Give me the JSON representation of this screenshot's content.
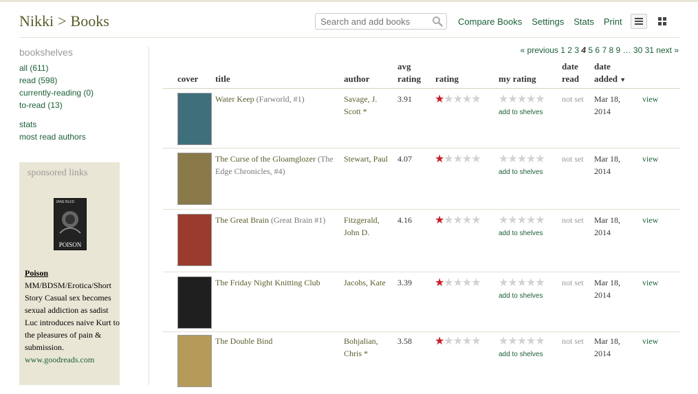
{
  "header": {
    "user": "Nikki",
    "separator": ">",
    "section": "Books",
    "search_placeholder": "Search and add books",
    "links": [
      "Compare Books",
      "Settings",
      "Stats",
      "Print"
    ],
    "divider": "|"
  },
  "sidebar": {
    "title": "bookshelves",
    "shelves": [
      "all (611)",
      "read (598)",
      "currently-reading (0)",
      "to-read (13)"
    ],
    "links": [
      "stats",
      "most read authors"
    ]
  },
  "sponsored": {
    "title": "sponsored links",
    "cover_title": "POISON",
    "cover_author": "JANE BLED",
    "ad_title": "Poison",
    "ad_body": "MM/BDSM/Erotica/Short Story Casual sex becomes sexual addiction as sadist Luc introduces naive Kurt to the pleasures of pain & submission.",
    "ad_url": "www.goodreads.com"
  },
  "pagination": {
    "previous": "« previous",
    "pages": [
      "1",
      "2",
      "3",
      "4",
      "5",
      "6",
      "7",
      "8",
      "9"
    ],
    "current": "4",
    "ellipsis": "…",
    "tail_pages": [
      "30",
      "31"
    ],
    "next": "next »"
  },
  "columns": {
    "cover": "cover",
    "title": "title",
    "author": "author",
    "avg_rating_1": "avg",
    "avg_rating_2": "rating",
    "rating": "rating",
    "my_rating": "my rating",
    "date_read_1": "date",
    "date_read_2": "read",
    "date_added_1": "date",
    "date_added_2": "added",
    "sort_arrow": "▼"
  },
  "books": [
    {
      "title": "Water Keep",
      "series": "(Farworld, #1)",
      "author_line1": "Savage, J.",
      "author_line2": "Scott *",
      "avg_rating": "3.91",
      "rating_stars": 1,
      "my_rating_stars": 0,
      "add_to_shelves": "add to shelves",
      "date_read": "not set",
      "date_added_1": "Mar 18,",
      "date_added_2": "2014",
      "view": "view",
      "cover_color": "#3e6f7a"
    },
    {
      "title": "The Curse of the Gloamglozer",
      "series": "(The Edge Chronicles, #4)",
      "author_line1": "Stewart, Paul",
      "author_line2": "",
      "avg_rating": "4.07",
      "rating_stars": 1,
      "my_rating_stars": 0,
      "add_to_shelves": "add to shelves",
      "date_read": "not set",
      "date_added_1": "Mar 18,",
      "date_added_2": "2014",
      "view": "view",
      "cover_color": "#8a7a4a"
    },
    {
      "title": "The Great Brain",
      "series": "(Great Brain #1)",
      "author_line1": "Fitzgerald,",
      "author_line2": "John D.",
      "avg_rating": "4.16",
      "rating_stars": 1,
      "my_rating_stars": 0,
      "add_to_shelves": "add to shelves",
      "date_read": "not set",
      "date_added_1": "Mar 18,",
      "date_added_2": "2014",
      "view": "view",
      "cover_color": "#9b3b2e"
    },
    {
      "title": "The Friday Night Knitting Club",
      "series": "",
      "author_line1": "Jacobs, Kate",
      "author_line2": "",
      "avg_rating": "3.39",
      "rating_stars": 1,
      "my_rating_stars": 0,
      "add_to_shelves": "add to shelves",
      "date_read": "not set",
      "date_added_1": "Mar 18,",
      "date_added_2": "2014",
      "view": "view",
      "cover_color": "#1f1f1f"
    },
    {
      "title": "The Double Bind",
      "series": "",
      "author_line1": "Bohjalian,",
      "author_line2": "Chris *",
      "avg_rating": "3.58",
      "rating_stars": 1,
      "my_rating_stars": 0,
      "add_to_shelves": "add to shelves",
      "date_read": "not set",
      "date_added_1": "Mar 18,",
      "date_added_2": "2014",
      "view": "view",
      "cover_color": "#b59a5a"
    }
  ]
}
